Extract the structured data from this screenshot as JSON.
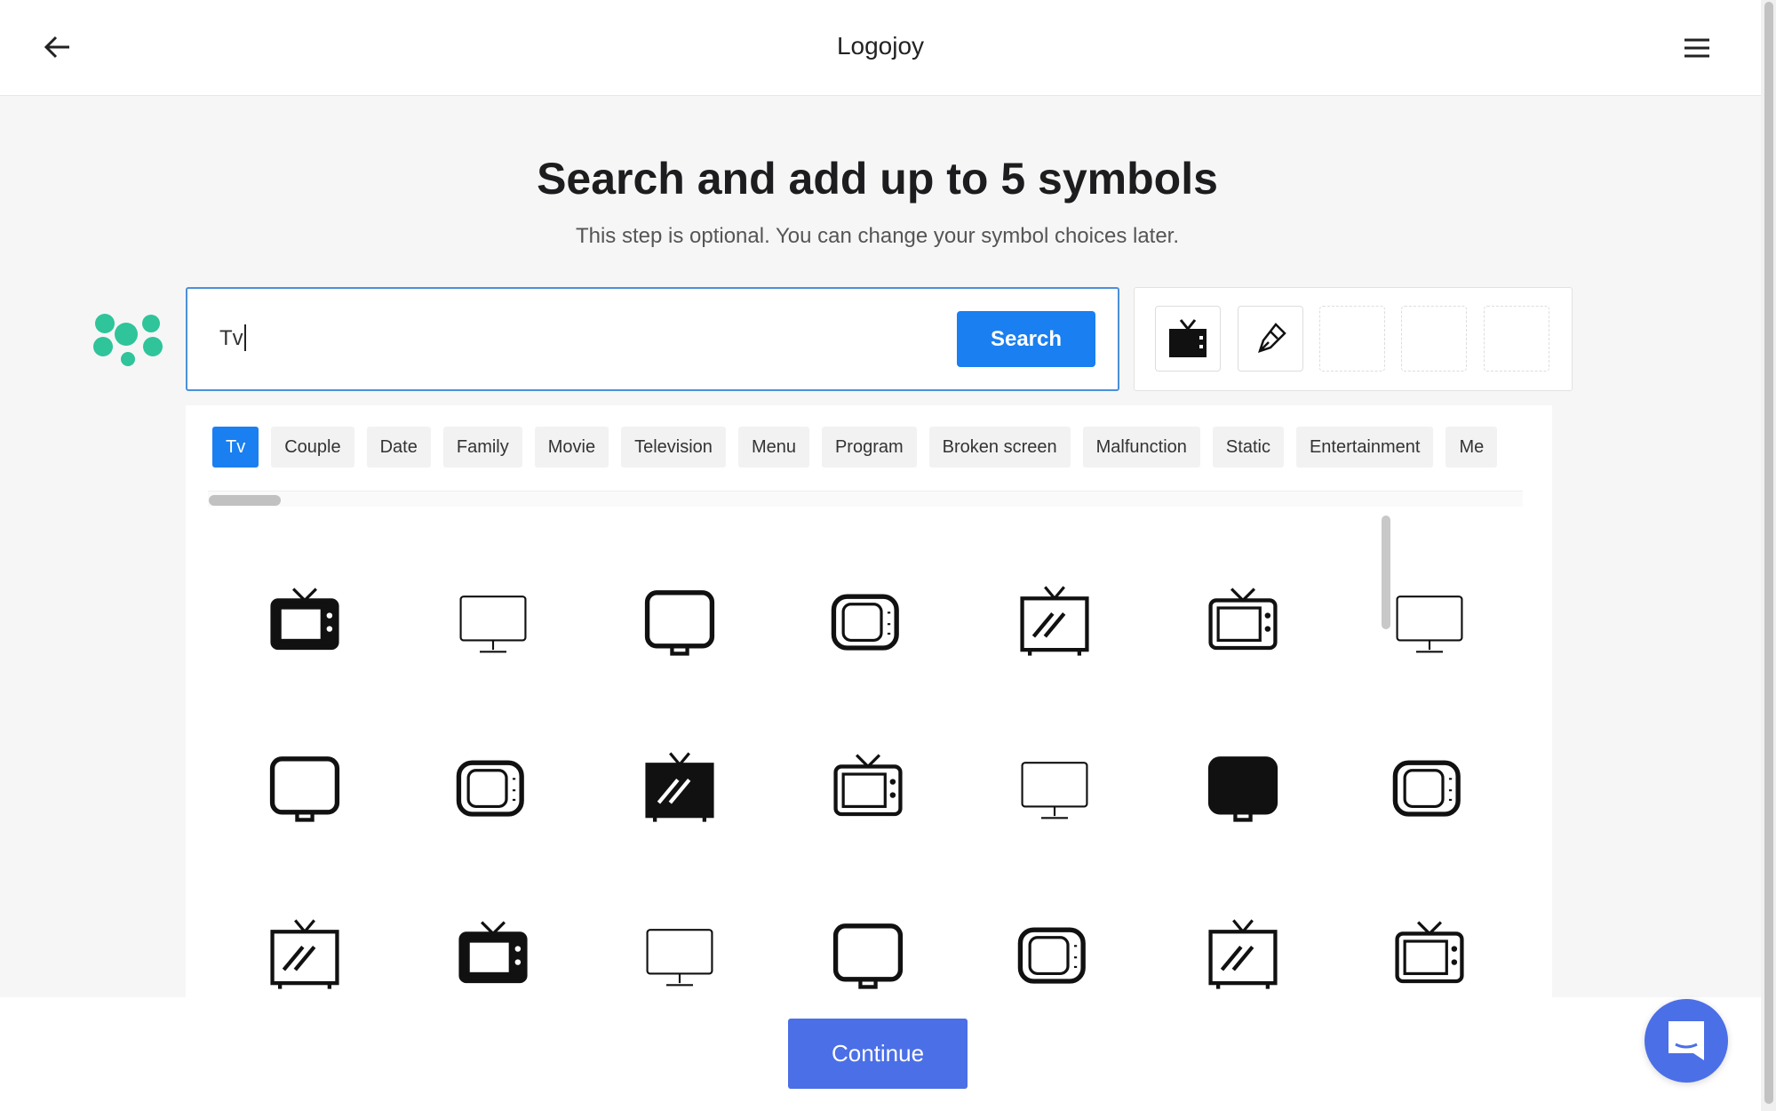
{
  "header": {
    "title": "Logojoy",
    "back_icon": "arrow-left-icon",
    "menu_icon": "hamburger-icon"
  },
  "main": {
    "heading": "Search and add up to 5 symbols",
    "subtitle": "This step is optional. You can change your symbol choices later.",
    "search": {
      "value": "Tv",
      "button_label": "Search"
    },
    "selected_symbols": [
      "tv-antenna-icon",
      "pen-nib-icon",
      null,
      null,
      null
    ],
    "tags": [
      "Tv",
      "Couple",
      "Date",
      "Family",
      "Movie",
      "Television",
      "Menu",
      "Program",
      "Broken screen",
      "Malfunction",
      "Static",
      "Entertainment",
      "Me"
    ],
    "active_tag": "Tv",
    "results": [
      [
        "tv-wave-icon",
        "monitor-off-icon",
        "tv-rounded-icon",
        "monitor-icon",
        "retro-tv-icon",
        "monitor-user-icon",
        "tv-antenna-outline-icon"
      ],
      [
        "monitor-thin-icon",
        "retro-tv-antenna-icon",
        "tv-stand-icon",
        "tv-antenna-small-icon",
        "tv-globe-icon",
        "curved-tv-leaf-icon",
        "tiny-tv-icon"
      ],
      [
        "tv-legs-icon",
        "tv-person-icon",
        "tv-striped-icon",
        "tv-rounded-antenna-icon",
        "tv-slash-icon",
        "tv-vintage-icon",
        "tv-speaker-icon"
      ]
    ]
  },
  "footer": {
    "continue_label": "Continue",
    "chat_icon": "chat-bubble-icon"
  },
  "colors": {
    "accent": "#1a7ff0",
    "continue": "#4b6fe6",
    "logo": "#2fc49a"
  }
}
